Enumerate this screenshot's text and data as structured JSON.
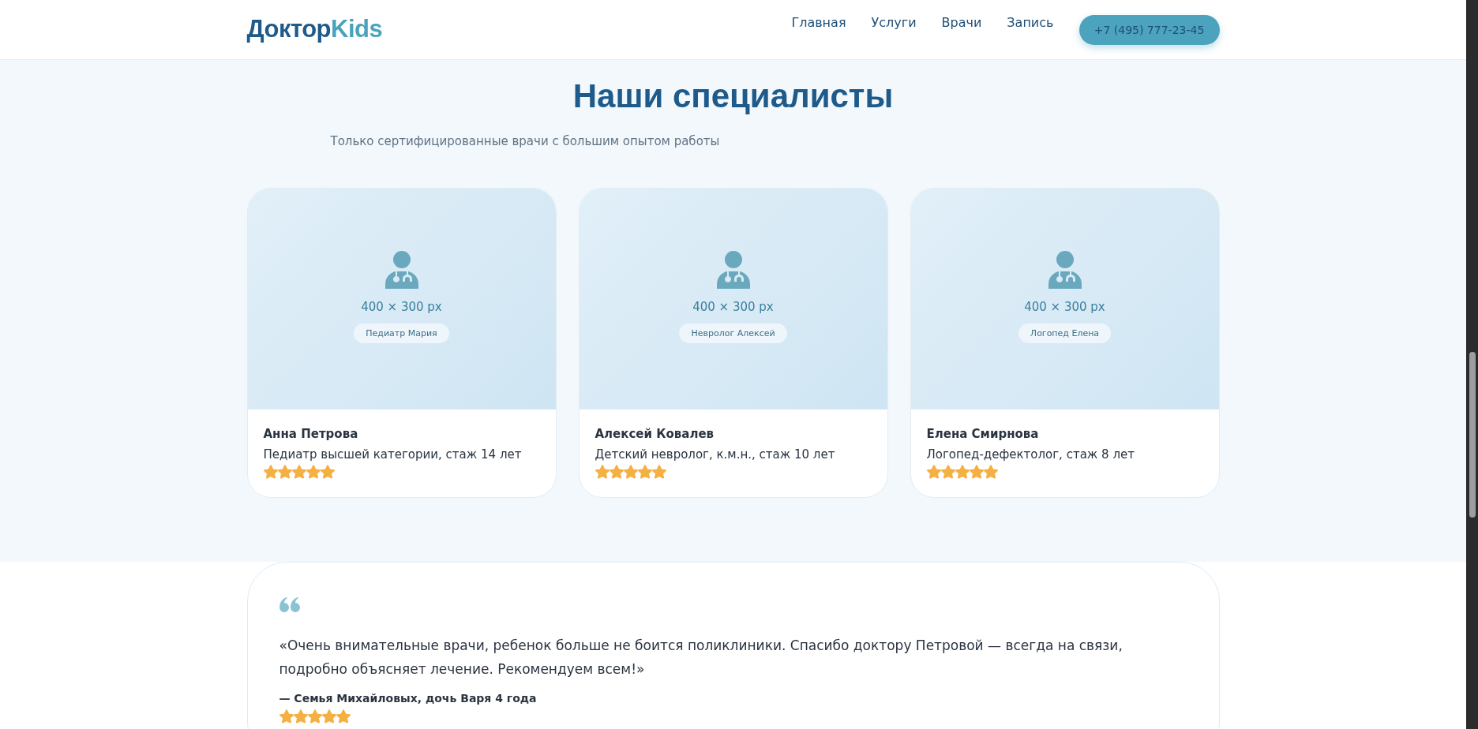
{
  "header": {
    "logo": {
      "part_1": "Доктор",
      "part_2": "Kids"
    },
    "nav": [
      {
        "label": "Главная"
      },
      {
        "label": "Услуги"
      },
      {
        "label": "Врачи"
      },
      {
        "label": "Запись"
      }
    ],
    "phone_button": "+7 (495) 777-23-45"
  },
  "specialists": {
    "title": "Наши специалисты",
    "subtitle": "Только сертифицированные врачи с большим опытом работы",
    "cards": [
      {
        "image_size": "400 × 300 px",
        "image_tag": "Педиатр Мария",
        "name": "Анна Петрова",
        "description": "Педиатр высшей категории, стаж 14 лет",
        "stars": 5
      },
      {
        "image_size": "400 × 300 px",
        "image_tag": "Невролог Алексей",
        "name": "Алексей Ковалев",
        "description": "Детский невролог, к.м.н., стаж 10 лет",
        "stars": 5
      },
      {
        "image_size": "400 × 300 px",
        "image_tag": "Логопед Елена",
        "name": "Елена Смирнова",
        "description": "Логопед-дефектолог, стаж 8 лет",
        "stars": 5
      }
    ]
  },
  "testimonial": {
    "quote": "«Очень внимательные врачи, ребенок больше не боится поликлиники. Спасибо доктору Петровой — всегда на связи, подробно объясняет лечение. Рекомендуем всем!»",
    "author": "— Семья Михайловых, дочь Варя 4 года",
    "stars": 5
  }
}
